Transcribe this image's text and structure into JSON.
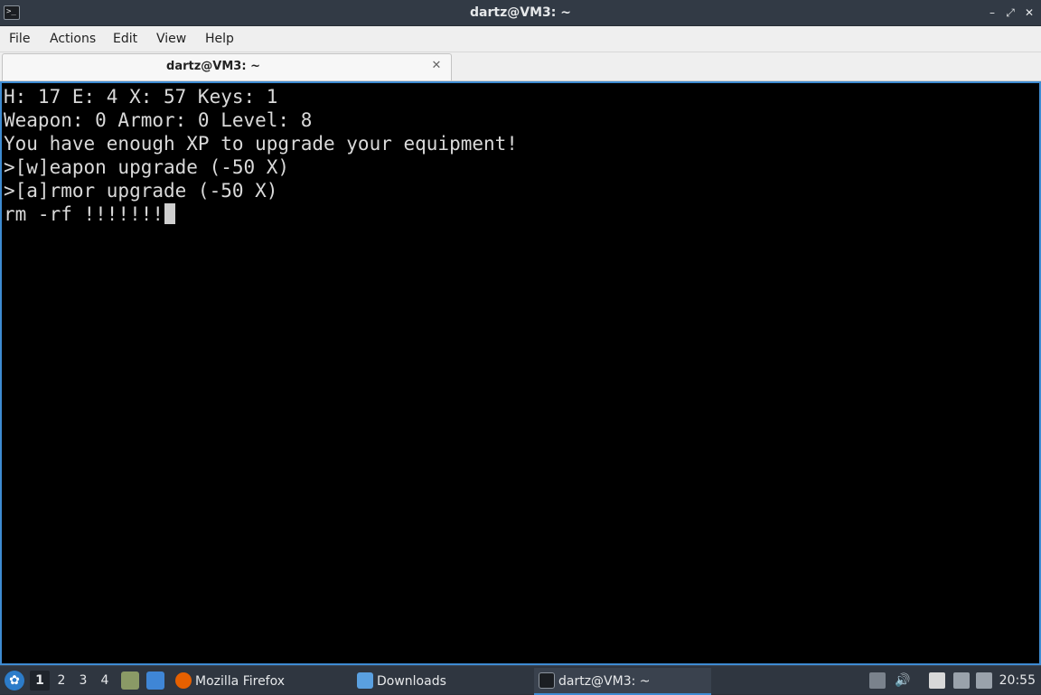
{
  "window": {
    "title": "dartz@VM3: ~",
    "app_icon": ">_",
    "minimize_glyph": "–",
    "maximize_glyph": "⤢",
    "close_glyph": "✕"
  },
  "menubar": {
    "items": [
      "File",
      "Actions",
      "Edit",
      "View",
      "Help"
    ]
  },
  "tabs": [
    {
      "label": "dartz@VM3: ~",
      "close_glyph": "✕"
    }
  ],
  "terminal": {
    "lines": [
      "H: 17 E: 4 X: 57 Keys: 1",
      "Weapon: 0 Armor: 0 Level: 8",
      "You have enough XP to upgrade your equipment!",
      ">[w]eapon upgrade (-50 X)",
      ">[a]rmor upgrade (-50 X)",
      "rm -rf !!!!!!!"
    ]
  },
  "taskbar": {
    "start_glyph": "✿",
    "workspaces": [
      "1",
      "2",
      "3",
      "4"
    ],
    "active_workspace": "1",
    "tasks": [
      {
        "label": "Mozilla Firefox",
        "icon": "firefox-icon",
        "color": "#e66000"
      },
      {
        "label": "Downloads",
        "icon": "folder-icon",
        "color": "#5aa0e0"
      },
      {
        "label": "dartz@VM3: ~",
        "icon": "terminal-icon",
        "color": "#1b1e22"
      }
    ],
    "tray": {
      "volume_glyph": "🔊",
      "clock": "20:55"
    }
  },
  "colors": {
    "accent": "#3e8bd2",
    "terminal_bg": "#000000",
    "terminal_fg": "#d9d9d9",
    "titlebar_bg": "#323a45",
    "taskbar_bg": "#2f3640"
  }
}
